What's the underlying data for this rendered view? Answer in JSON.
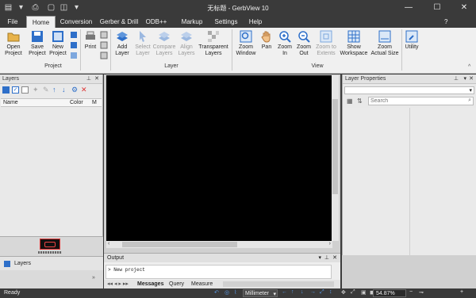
{
  "window": {
    "title": "无标题 - GerbView 10"
  },
  "tabs": [
    "File",
    "Home",
    "Conversion",
    "Gerber & Drill",
    "ODB++",
    "Markup",
    "Settings",
    "Help"
  ],
  "ribbon": {
    "open_project": "Open\nProject",
    "save_project": "Save\nProject",
    "new_project": "New\nProject",
    "print": "Print",
    "add_layer": "Add\nLayer",
    "select_layer": "Select\nLayer",
    "compare_layers": "Compare\nLayers",
    "align_layers": "Align\nLayers",
    "transparent_layers": "Transparent\nLayers",
    "zoom_window": "Zoom\nWindow",
    "pan": "Pan",
    "zoom_in": "Zoom\nIn",
    "zoom_out": "Zoom\nOut",
    "zoom_extents": "Zoom to\nExtents",
    "show_workspace": "Show\nWorkspace",
    "zoom_actual_size": "Zoom\nActual Size",
    "utility": "Utility",
    "group_project": "Project",
    "group_layer": "Layer",
    "group_view": "View"
  },
  "layers_panel": {
    "title": "Layers",
    "col_name": "Name",
    "col_color": "Color",
    "col_m": "M",
    "bottom_tab": "Layers"
  },
  "properties_panel": {
    "title": "Layer Properties",
    "search_placeholder": "Search"
  },
  "output_panel": {
    "title": "Output",
    "message": "New project",
    "tabs": [
      "Messages",
      "Query",
      "Measure"
    ]
  },
  "statusbar": {
    "status": "Ready",
    "units": "Millimeter",
    "zoom": "54.87%"
  },
  "colors": {
    "accent": "#2e6fc9",
    "chrome": "#3a3a3a",
    "ribbon": "#f0f0f0"
  }
}
